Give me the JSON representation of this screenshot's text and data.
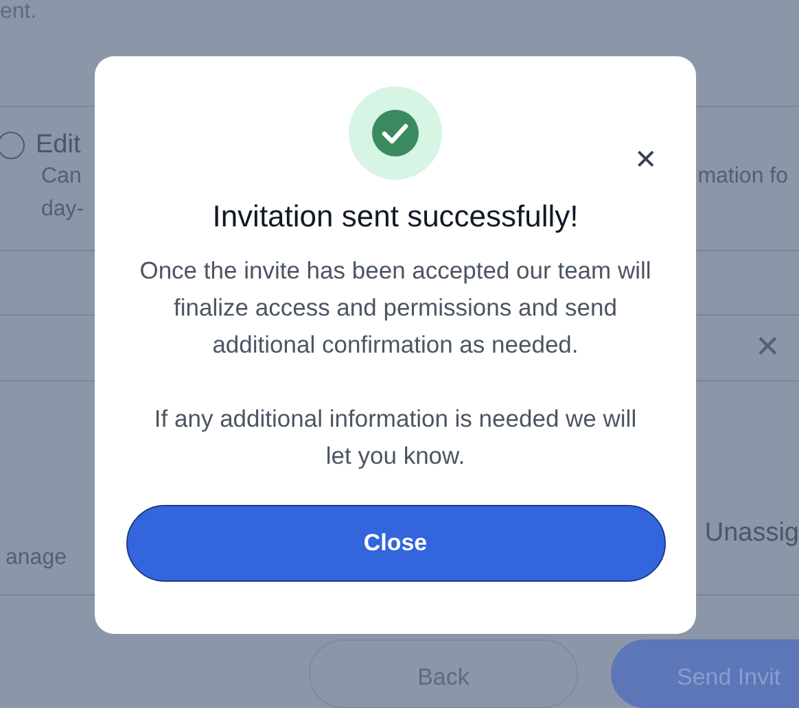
{
  "background": {
    "top_text": "ent.",
    "role_option": {
      "label": "Edit",
      "selected": false,
      "description_start": "Can",
      "description_end": "mation fo",
      "description_line_2": "day-"
    },
    "row_close": "✕",
    "left_text": "anage",
    "right_text": "Unassig",
    "back_button": "Back",
    "send_button": "Send Invit"
  },
  "dialog": {
    "title": "Invitation sent successfully!",
    "paragraphs": [
      "Once the invite has been accepted our team will finalize access and permissions and send additional confirmation as needed.",
      "If any additional information is needed we will let you know."
    ],
    "close_icon": "✕",
    "button": "Close"
  }
}
